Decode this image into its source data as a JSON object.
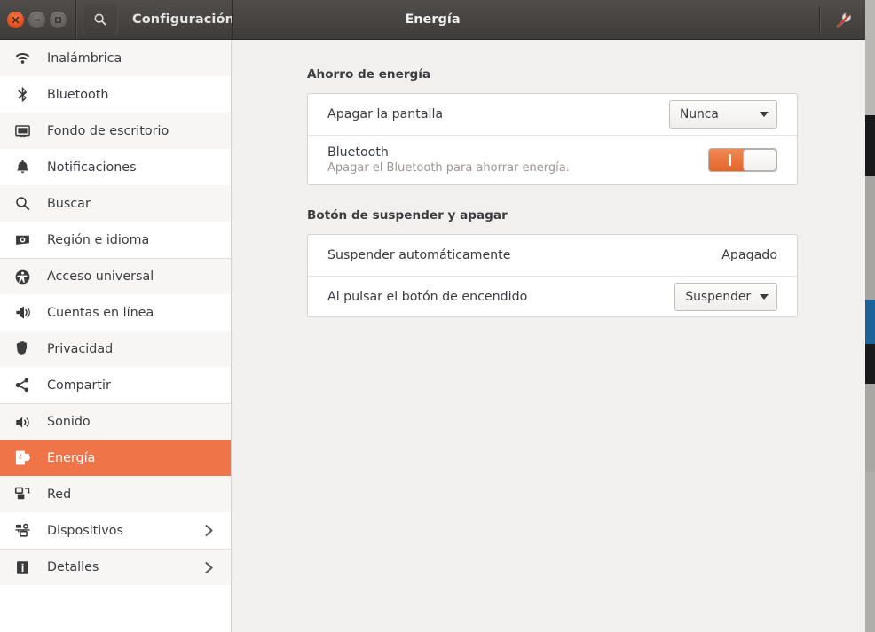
{
  "window": {
    "app_title": "Configuración",
    "page_title": "Energía",
    "search_icon": "search-icon",
    "gear_icon": "settings-wrench-icon",
    "close_icon": "close-icon",
    "minimize_icon": "minimize-icon",
    "maximize_icon": "maximize-icon"
  },
  "sidebar": {
    "items": [
      {
        "label": "Inalámbrica",
        "icon": "wifi-icon",
        "selected": false,
        "chevron": false
      },
      {
        "label": "Bluetooth",
        "icon": "bluetooth-icon",
        "selected": false,
        "chevron": false
      },
      {
        "label": "Fondo de escritorio",
        "icon": "desktop-background-icon",
        "selected": false,
        "chevron": false
      },
      {
        "label": "Notificaciones",
        "icon": "bell-icon",
        "selected": false,
        "chevron": false
      },
      {
        "label": "Buscar",
        "icon": "search-icon",
        "selected": false,
        "chevron": false
      },
      {
        "label": "Región e idioma",
        "icon": "region-language-icon",
        "selected": false,
        "chevron": false
      },
      {
        "label": "Acceso universal",
        "icon": "accessibility-icon",
        "selected": false,
        "chevron": false
      },
      {
        "label": "Cuentas en línea",
        "icon": "online-accounts-icon",
        "selected": false,
        "chevron": false
      },
      {
        "label": "Privacidad",
        "icon": "privacy-hand-icon",
        "selected": false,
        "chevron": false
      },
      {
        "label": "Compartir",
        "icon": "share-icon",
        "selected": false,
        "chevron": false
      },
      {
        "label": "Sonido",
        "icon": "speaker-icon",
        "selected": false,
        "chevron": false
      },
      {
        "label": "Energía",
        "icon": "power-plug-icon",
        "selected": true,
        "chevron": false
      },
      {
        "label": "Red",
        "icon": "network-icon",
        "selected": false,
        "chevron": false
      },
      {
        "label": "Dispositivos",
        "icon": "devices-icon",
        "selected": false,
        "chevron": true
      },
      {
        "label": "Detalles",
        "icon": "info-icon",
        "selected": false,
        "chevron": true
      }
    ]
  },
  "main": {
    "sections": [
      {
        "title": "Ahorro de energía",
        "rows": [
          {
            "label": "Apagar la pantalla",
            "sub": "",
            "control": "combo",
            "value": "Nunca"
          },
          {
            "label": "Bluetooth",
            "sub": "Apagar el Bluetooth para ahorrar energía.",
            "control": "toggle",
            "value": "on"
          }
        ]
      },
      {
        "title": "Botón de suspender y apagar",
        "rows": [
          {
            "label": "Suspender automáticamente",
            "sub": "",
            "control": "text",
            "value": "Apagado"
          },
          {
            "label": "Al pulsar el botón de encendido",
            "sub": "",
            "control": "combo",
            "value": "Suspender"
          }
        ]
      }
    ]
  },
  "colors": {
    "accent": "#ef7548",
    "titlebar": "#45423f",
    "panel_bg": "#ffffff",
    "content_bg": "#f1f0ee"
  }
}
